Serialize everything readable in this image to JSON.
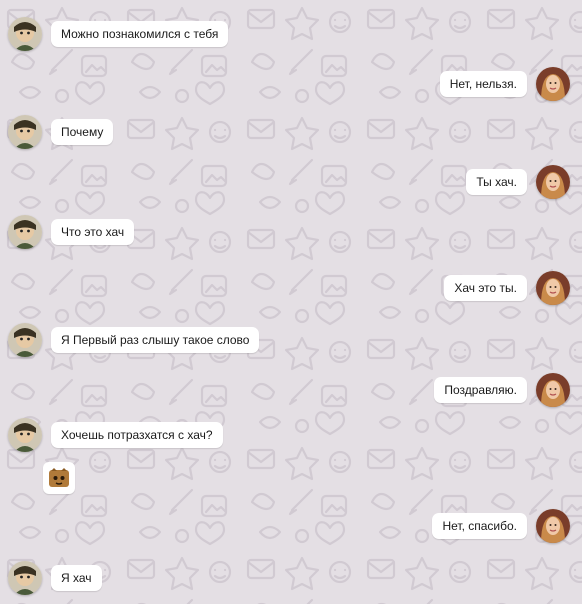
{
  "chat": {
    "theme": {
      "background": "#e4dfe4",
      "pattern_color": "#d1cad2",
      "bubble": "#ffffff",
      "text": "#1a1a1a"
    },
    "messages": [
      {
        "side": "in",
        "text": "Можно познакомился с тебя"
      },
      {
        "side": "out",
        "text": "Нет, нельзя."
      },
      {
        "side": "in",
        "text": "Почему"
      },
      {
        "side": "out",
        "text": "Ты хач."
      },
      {
        "side": "in",
        "text": "Что это хач"
      },
      {
        "side": "out",
        "text": "Хач это ты."
      },
      {
        "side": "in",
        "text": "Я Первый раз слышу такое слово"
      },
      {
        "side": "out",
        "text": "Поздравляю."
      },
      {
        "side": "in",
        "text": "Хочешь потразхатся с хач?"
      },
      {
        "side": "out",
        "text": "Нет, спасибо."
      },
      {
        "side": "in",
        "text": "Я хач"
      }
    ],
    "sticker_icon": "cat-face-sticker"
  }
}
